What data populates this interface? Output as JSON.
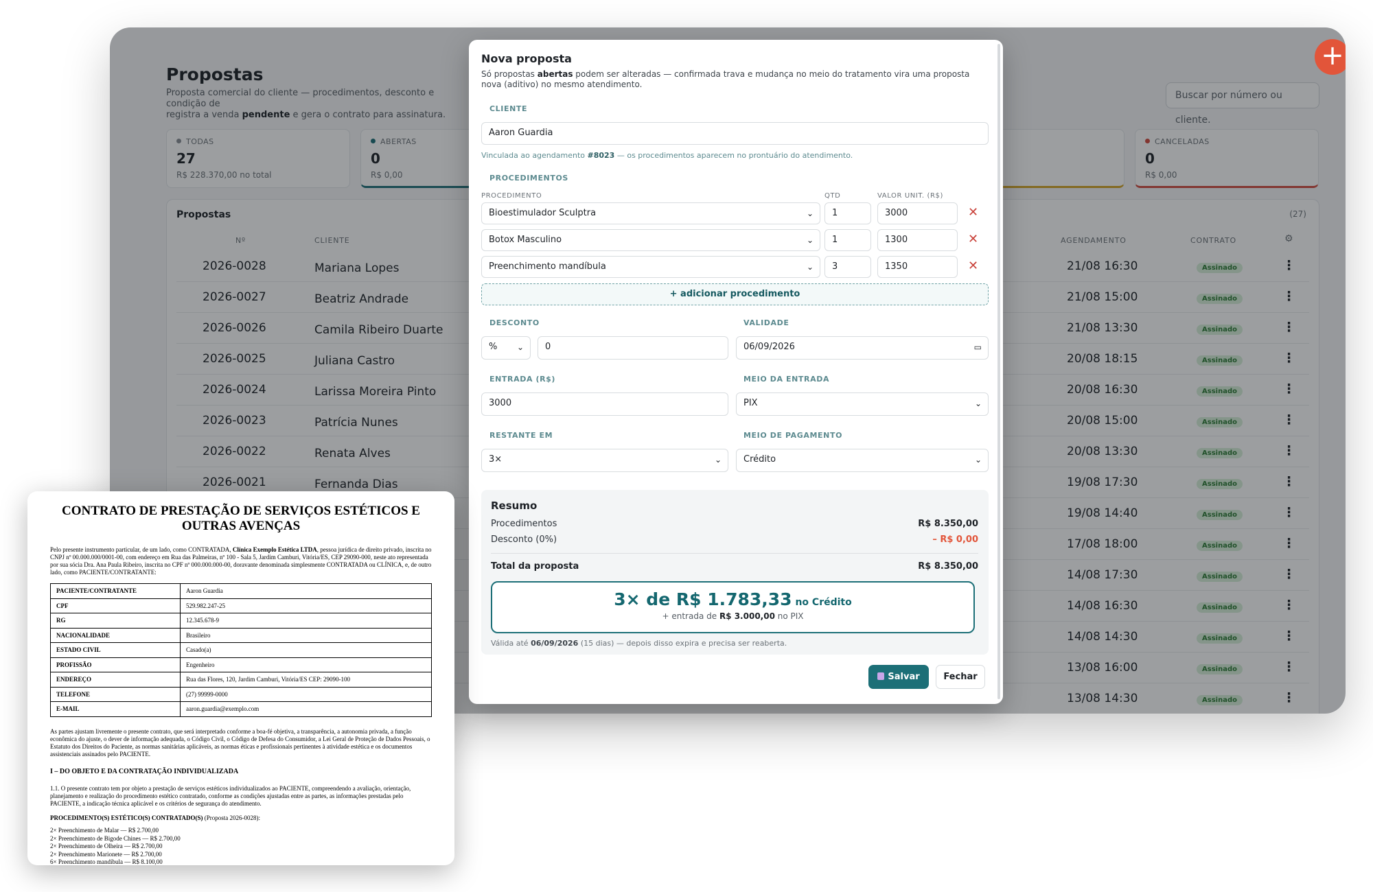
{
  "page": {
    "title": "Propostas",
    "subtitle_pre": "Proposta comercial do cliente — procedimentos, desconto e condição de pagamento. Confirmada,",
    "subtitle_mid": " registra a venda ",
    "subtitle_bold": "pendente",
    "subtitle_post": " e gera o contrato para assinatura.",
    "subtitle_line1": "Proposta comercial do cliente — procedimentos, desconto e condição de",
    "subtitle_line2_pre": "registra a venda ",
    "search_placeholder": "Buscar por número ou cliente.",
    "fab_label": "+"
  },
  "stats": [
    {
      "label": "TODAS",
      "count": "27",
      "total": "R$ 228.370,00 no total",
      "color": "#8a9096"
    },
    {
      "label": "ABERTAS",
      "count": "0",
      "total": "R$ 0,00",
      "color": "#1c6f77"
    },
    {
      "label": "CANCELADAS",
      "count": "0",
      "total": "R$ 0,00",
      "color": "#d24a3f"
    }
  ],
  "stat_colors": {
    "hidden_1": "#d5a423"
  },
  "table": {
    "title": "Propostas",
    "count": "(27)",
    "headers": {
      "num": "Nº",
      "client": "CLIENTE",
      "schedule": "AGENDAMENTO",
      "contract": "CONTRATO"
    },
    "rows": [
      {
        "num": "2026-0028",
        "client": "Mariana Lopes",
        "schedule": "21/08 16:30",
        "contract": "Assinado"
      },
      {
        "num": "2026-0027",
        "client": "Beatriz Andrade",
        "schedule": "21/08 15:00",
        "contract": "Assinado"
      },
      {
        "num": "2026-0026",
        "client": "Camila Ribeiro Duarte",
        "schedule": "21/08 13:30",
        "contract": "Assinado"
      },
      {
        "num": "2026-0025",
        "client": "Juliana Castro",
        "schedule": "20/08 18:15",
        "contract": "Assinado"
      },
      {
        "num": "2026-0024",
        "client": "Larissa Moreira Pinto",
        "schedule": "20/08 16:30",
        "contract": "Assinado"
      },
      {
        "num": "2026-0023",
        "client": "Patrícia Nunes",
        "schedule": "20/08 15:00",
        "contract": "Assinado"
      },
      {
        "num": "2026-0022",
        "client": "Renata Alves",
        "schedule": "20/08 13:30",
        "contract": "Assinado"
      },
      {
        "num": "2026-0021",
        "client": "Fernanda Dias",
        "schedule": "19/08 17:30",
        "contract": "Assinado"
      },
      {
        "num": "",
        "client": "",
        "schedule": "19/08 14:40",
        "contract": "Assinado"
      },
      {
        "num": "",
        "client": "",
        "schedule": "17/08 18:00",
        "contract": "Assinado"
      },
      {
        "num": "",
        "client": "",
        "schedule": "14/08 17:30",
        "contract": "Assinado"
      },
      {
        "num": "",
        "client": "",
        "schedule": "14/08 16:30",
        "contract": "Assinado"
      },
      {
        "num": "",
        "client": "",
        "schedule": "14/08 14:30",
        "contract": "Assinado"
      },
      {
        "num": "",
        "client": "",
        "schedule": "13/08 16:00",
        "contract": "Assinado"
      },
      {
        "num": "",
        "client": "",
        "schedule": "13/08 14:30",
        "contract": "Assinado"
      }
    ]
  },
  "modal": {
    "title": "Nova proposta",
    "sub_pre": "Só propostas ",
    "sub_bold": "abertas",
    "sub_post": " podem ser alteradas — confirmada trava e mudança no meio do tratamento vira uma proposta nova (aditivo) no mesmo atendimento.",
    "client_label": "CLIENTE",
    "client_value": "Aaron Guardia",
    "link_pre": "Vinculada ao agendamento ",
    "link_bold": "#8023",
    "link_post": " — os procedimentos aparecem no prontuário do atendimento.",
    "procedures_label": "PROCEDIMENTOS",
    "col_procedure": "PROCEDIMENTO",
    "col_qty": "QTD",
    "col_unit": "VALOR UNIT. (R$)",
    "procedures": [
      {
        "name": "Bioestimulador Sculptra",
        "qty": "1",
        "unit": "3000"
      },
      {
        "name": "Botox Masculino",
        "qty": "1",
        "unit": "1300"
      },
      {
        "name": "Preenchimento mandíbula",
        "qty": "3",
        "unit": "1350"
      }
    ],
    "add_procedure": "+ adicionar procedimento",
    "discount_label": "DESCONTO",
    "discount_type": "%",
    "discount_value": "0",
    "validity_label": "VALIDADE",
    "validity_value": "06/09/2026",
    "entry_label": "ENTRADA (R$)",
    "entry_value": "3000",
    "entry_method_label": "MEIO DA ENTRADA",
    "entry_method_value": "PIX",
    "remaining_label": "RESTANTE EM",
    "remaining_value": "3×",
    "payment_method_label": "MEIO DE PAGAMENTO",
    "payment_method_value": "Crédito",
    "summary": {
      "title": "Resumo",
      "procedures_label": "Procedimentos",
      "procedures_value": "R$ 8.350,00",
      "discount_label": "Desconto (0%)",
      "discount_value": "– R$ 0,00",
      "total_label": "Total da proposta",
      "total_value": "R$ 8.350,00",
      "installment_main": "3× de R$ 1.783,33",
      "installment_method": " no Crédito",
      "entry_pre": "+ entrada de ",
      "entry_bold": "R$ 3.000,00",
      "entry_post": " no PIX",
      "valid_pre": "Válida até ",
      "valid_bold": "06/09/2026",
      "valid_post": " (15 dias) — depois disso expira e precisa ser reaberta."
    },
    "save_label": "Salvar",
    "close_label": "Fechar"
  },
  "contract": {
    "title": "CONTRATO DE PRESTAÇÃO DE SERVIÇOS ESTÉTICOS E OUTRAS AVENÇAS",
    "intro_pre": "Pelo presente instrumento particular, de um lado, como CONTRATADA, ",
    "intro_bold": "Clínica Exemplo Estética LTDA",
    "intro_post": ", pessoa jurídica de direito privado, inscrita no CNPJ nº 00.000.000/0001-00, com endereço em Rua das Palmeiras, nº 100 - Sala 5, Jardim Camburi, Vitória/ES, CEP 29090-000, neste ato representada por sua sócia Dra. Ana Paula Ribeiro, inscrita no CPF nº 000.000.000-00, doravante denominada simplesmente CONTRATADA ou CLÍNICA, e, de outro lado, como PACIENTE/CONTRATANTE:",
    "fields": [
      {
        "k": "PACIENTE/CONTRATANTE",
        "v": "Aaron Guardia"
      },
      {
        "k": "CPF",
        "v": "529.982.247-25"
      },
      {
        "k": "RG",
        "v": "12.345.678-9"
      },
      {
        "k": "NACIONALIDADE",
        "v": "Brasileiro"
      },
      {
        "k": "ESTADO CIVIL",
        "v": "Casado(a)"
      },
      {
        "k": "PROFISSÃO",
        "v": "Engenheiro"
      },
      {
        "k": "ENDEREÇO",
        "v": "Rua das Flores, 120, Jardim Camburi, Vitória/ES CEP: 29090-100"
      },
      {
        "k": "TELEFONE",
        "v": "(27) 99999-0000"
      },
      {
        "k": "E-MAIL",
        "v": "aaron.guardia@exemplo.com"
      }
    ],
    "para1": "As partes ajustam livremente o presente contrato, que será interpretado conforme a boa-fé objetiva, a transparência, a autonomia privada, a função econômica do ajuste, o dever de informação adequada, o Código Civil, o Código de Defesa do Consumidor, a Lei Geral de Proteção de Dados Pessoais, o Estatuto dos Direitos do Paciente, as normas sanitárias aplicáveis, as normas éticas e profissionais pertinentes à atividade estética e os documentos assistenciais assinados pelo PACIENTE.",
    "heading1": "I – DO OBJETO E DA CONTRATAÇÃO INDIVIDUALIZADA",
    "para2": "1.1. O presente contrato tem por objeto a prestação de serviços estéticos individualizados ao PACIENTE, compreendendo a avaliação, orientação, planejamento e realização do procedimento estético contratado, conforme as condições ajustadas entre as partes, as informações prestadas pelo PACIENTE, a indicação técnica aplicável e os critérios de segurança do atendimento.",
    "heading2_bold": "PROCEDIMENTO(S) ESTÉTICO(S) CONTRATADO(S)",
    "heading2_rest": " (Proposta 2026-0028):",
    "items": [
      "2× Preenchimento de Malar — R$ 2.700,00",
      "2× Preenchimento de Bigode Chines — R$ 2.700,00",
      "2× Preenchimento de Olheira — R$ 2.700,00",
      "2× Preenchimento Marionete — R$ 2.700,00",
      "6× Preenchimento mandíbula — R$ 8.100,00"
    ]
  }
}
